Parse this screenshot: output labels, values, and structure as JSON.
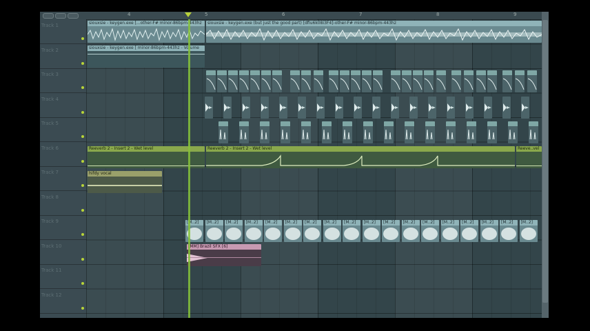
{
  "ruler": {
    "marks": [
      "4",
      "5",
      "6",
      "7",
      "8",
      "9"
    ]
  },
  "tracks": [
    {
      "name": "Track 1"
    },
    {
      "name": "Track 2"
    },
    {
      "name": "Track 3"
    },
    {
      "name": "Track 4"
    },
    {
      "name": "Track 5"
    },
    {
      "name": "Track 6"
    },
    {
      "name": "Track 7"
    },
    {
      "name": "Track 8"
    },
    {
      "name": "Track 9"
    },
    {
      "name": "Track 10"
    },
    {
      "name": "Track 11"
    },
    {
      "name": "Track 12"
    }
  ],
  "clips": {
    "track1_a": "siouxsie - keygen.exe [...other-F# minor-86bpm-443hz",
    "track1_b": "siouxsie - keygen.exe (but just the good part) [dfiu6k08i3F4]-other-F# minor-86bpm-443hz",
    "track2_a": "siouxsie - keygen.exe [  minor-86bpm-443hz - Volume",
    "track6_a": "Reeverb 2 - Insert 2 - Wet level",
    "track6_b": "Reeverb 2 - Insert 2 - Wet level",
    "track6_c": "Reeve..vel",
    "track7_a": "hifdy vocal",
    "track9_label": "[M..2]",
    "track10_a": "[MM] Brazil SFX [6]"
  },
  "colors": {
    "accent": "#b8d438",
    "playhead": "#86c23a",
    "audio_clip": "#8fb3b8",
    "automation_clip": "#8aa84c",
    "sfx_clip": "#c79ab2"
  },
  "icons": [
    "play-marker-icon",
    "track-led-icon"
  ]
}
